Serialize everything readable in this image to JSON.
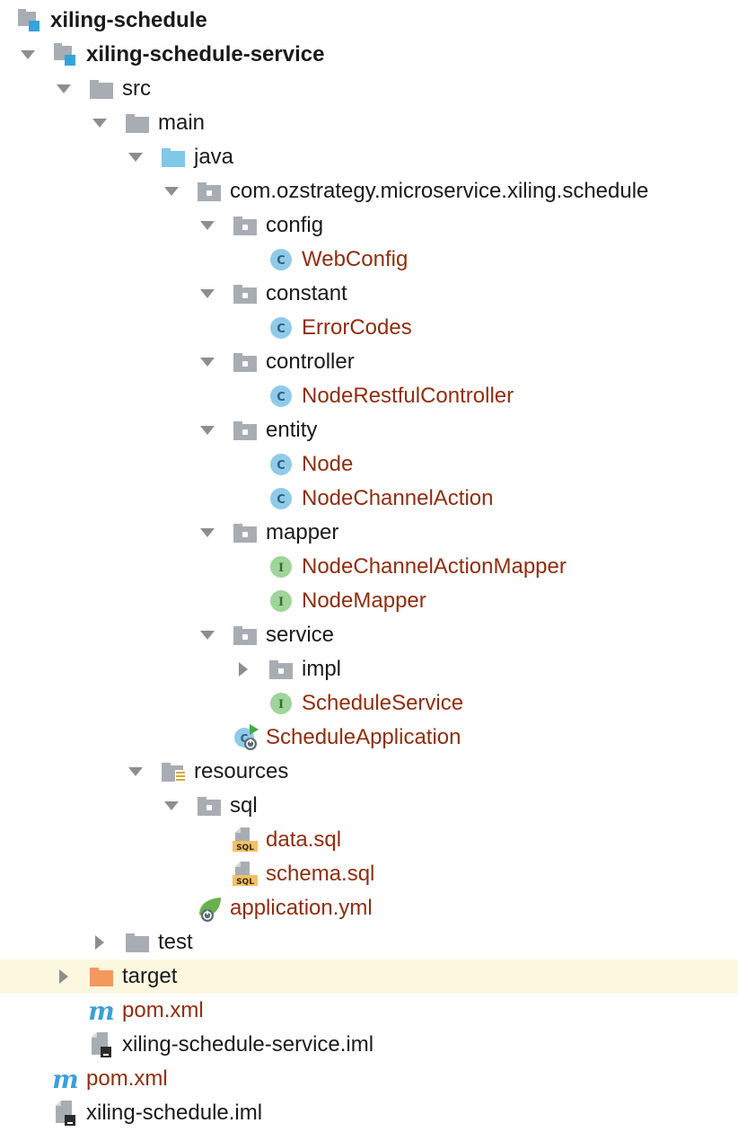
{
  "tree": {
    "nodes": [
      {
        "label": "xiling-schedule",
        "icon": "module-icon",
        "arrow": "none",
        "style": "bold"
      },
      {
        "label": "xiling-schedule-service",
        "icon": "module-icon",
        "arrow": "down",
        "style": "bold"
      },
      {
        "label": "src",
        "icon": "folder-icon",
        "arrow": "down",
        "style": "normal"
      },
      {
        "label": "main",
        "icon": "folder-icon",
        "arrow": "down",
        "style": "normal"
      },
      {
        "label": "java",
        "icon": "source-folder-icon",
        "arrow": "down",
        "style": "normal"
      },
      {
        "label": "com.ozstrategy.microservice.xiling.schedule",
        "icon": "package-icon",
        "arrow": "down",
        "style": "normal"
      },
      {
        "label": "config",
        "icon": "package-icon",
        "arrow": "down",
        "style": "normal"
      },
      {
        "label": "WebConfig",
        "icon": "class-icon",
        "arrow": "none",
        "style": "brown"
      },
      {
        "label": "constant",
        "icon": "package-icon",
        "arrow": "down",
        "style": "normal"
      },
      {
        "label": "ErrorCodes",
        "icon": "class-icon",
        "arrow": "none",
        "style": "brown"
      },
      {
        "label": "controller",
        "icon": "package-icon",
        "arrow": "down",
        "style": "normal"
      },
      {
        "label": "NodeRestfulController",
        "icon": "class-icon",
        "arrow": "none",
        "style": "brown"
      },
      {
        "label": "entity",
        "icon": "package-icon",
        "arrow": "down",
        "style": "normal"
      },
      {
        "label": "Node",
        "icon": "class-icon",
        "arrow": "none",
        "style": "brown"
      },
      {
        "label": "NodeChannelAction",
        "icon": "class-icon",
        "arrow": "none",
        "style": "brown"
      },
      {
        "label": "mapper",
        "icon": "package-icon",
        "arrow": "down",
        "style": "normal"
      },
      {
        "label": "NodeChannelActionMapper",
        "icon": "interface-icon",
        "arrow": "none",
        "style": "brown"
      },
      {
        "label": "NodeMapper",
        "icon": "interface-icon",
        "arrow": "none",
        "style": "brown"
      },
      {
        "label": "service",
        "icon": "package-icon",
        "arrow": "down",
        "style": "normal"
      },
      {
        "label": "impl",
        "icon": "package-icon",
        "arrow": "right",
        "style": "normal"
      },
      {
        "label": "ScheduleService",
        "icon": "interface-icon",
        "arrow": "none",
        "style": "brown"
      },
      {
        "label": "ScheduleApplication",
        "icon": "spring-boot-class-icon",
        "arrow": "none",
        "style": "brown"
      },
      {
        "label": "resources",
        "icon": "resources-folder-icon",
        "arrow": "down",
        "style": "normal"
      },
      {
        "label": "sql",
        "icon": "package-icon",
        "arrow": "down",
        "style": "normal"
      },
      {
        "label": "data.sql",
        "icon": "sql-file-icon",
        "arrow": "none",
        "style": "brown"
      },
      {
        "label": "schema.sql",
        "icon": "sql-file-icon",
        "arrow": "none",
        "style": "brown"
      },
      {
        "label": "application.yml",
        "icon": "spring-config-icon",
        "arrow": "none",
        "style": "brown"
      },
      {
        "label": "test",
        "icon": "folder-icon",
        "arrow": "right",
        "style": "normal"
      },
      {
        "label": "target",
        "icon": "excluded-folder-icon",
        "arrow": "right",
        "style": "normal",
        "selected": true
      },
      {
        "label": "pom.xml",
        "icon": "maven-icon",
        "arrow": "none",
        "style": "brown"
      },
      {
        "label": "xiling-schedule-service.iml",
        "icon": "iml-file-icon",
        "arrow": "none",
        "style": "normal"
      },
      {
        "label": "pom.xml",
        "icon": "maven-icon",
        "arrow": "none",
        "style": "brown"
      },
      {
        "label": "xiling-schedule.iml",
        "icon": "iml-file-icon",
        "arrow": "none",
        "style": "normal"
      }
    ]
  },
  "colors": {
    "folder_gray": "#a8adb3",
    "source_blue": "#7fc8e8",
    "class_circle": "#8fcbe8",
    "interface_circle": "#9fd49a",
    "excluded_orange": "#f39a5c",
    "file_label_brown": "#8f2e0e",
    "selection_bg": "#fcf7df",
    "maven_blue": "#3d9fd9"
  }
}
